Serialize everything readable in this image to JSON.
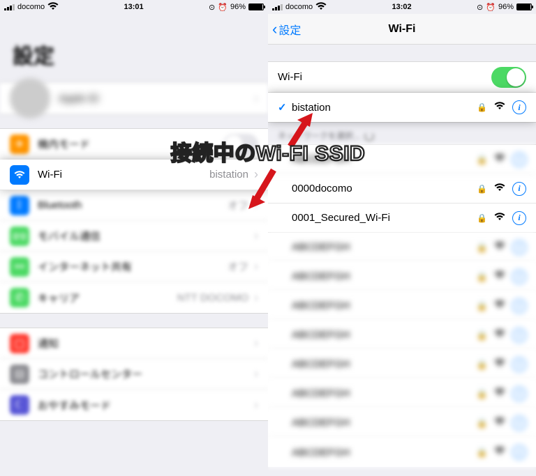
{
  "left": {
    "status": {
      "carrier": "docomo",
      "time": "13:01",
      "battery": "96%"
    },
    "title": "設定",
    "rows": {
      "airplane": "機内モード",
      "wifi": {
        "label": "Wi-Fi",
        "value": "bistation"
      },
      "bluetooth": {
        "label": "Bluetooth",
        "value": "オフ"
      },
      "cellular": "モバイル通信",
      "hotspot": {
        "label": "インターネット共有",
        "value": "オフ"
      },
      "carrier": {
        "label": "キャリア",
        "value": "NTT DOCOMO"
      },
      "notifications": "通知",
      "controlcenter": "コントロールセンター",
      "dnd": "おやすみモード"
    }
  },
  "right": {
    "status": {
      "carrier": "docomo",
      "time": "13:02",
      "battery": "96%"
    },
    "back": "設定",
    "title": "Wi-Fi",
    "wifi_toggle_label": "Wi-Fi",
    "connected_ssid": "bistation",
    "choose_label": "ネットワークを選択...",
    "networks": [
      {
        "ssid": "",
        "blur": true
      },
      {
        "ssid": "0000docomo",
        "blur": false
      },
      {
        "ssid": "0001_Secured_Wi-Fi",
        "blur": false
      },
      {
        "ssid": "",
        "blur": true
      },
      {
        "ssid": "",
        "blur": true
      },
      {
        "ssid": "",
        "blur": true
      },
      {
        "ssid": "",
        "blur": true
      },
      {
        "ssid": "",
        "blur": true
      },
      {
        "ssid": "",
        "blur": true
      },
      {
        "ssid": "",
        "blur": true
      },
      {
        "ssid": "",
        "blur": true
      }
    ]
  },
  "annotation": "接続中のWi-FI SSID"
}
